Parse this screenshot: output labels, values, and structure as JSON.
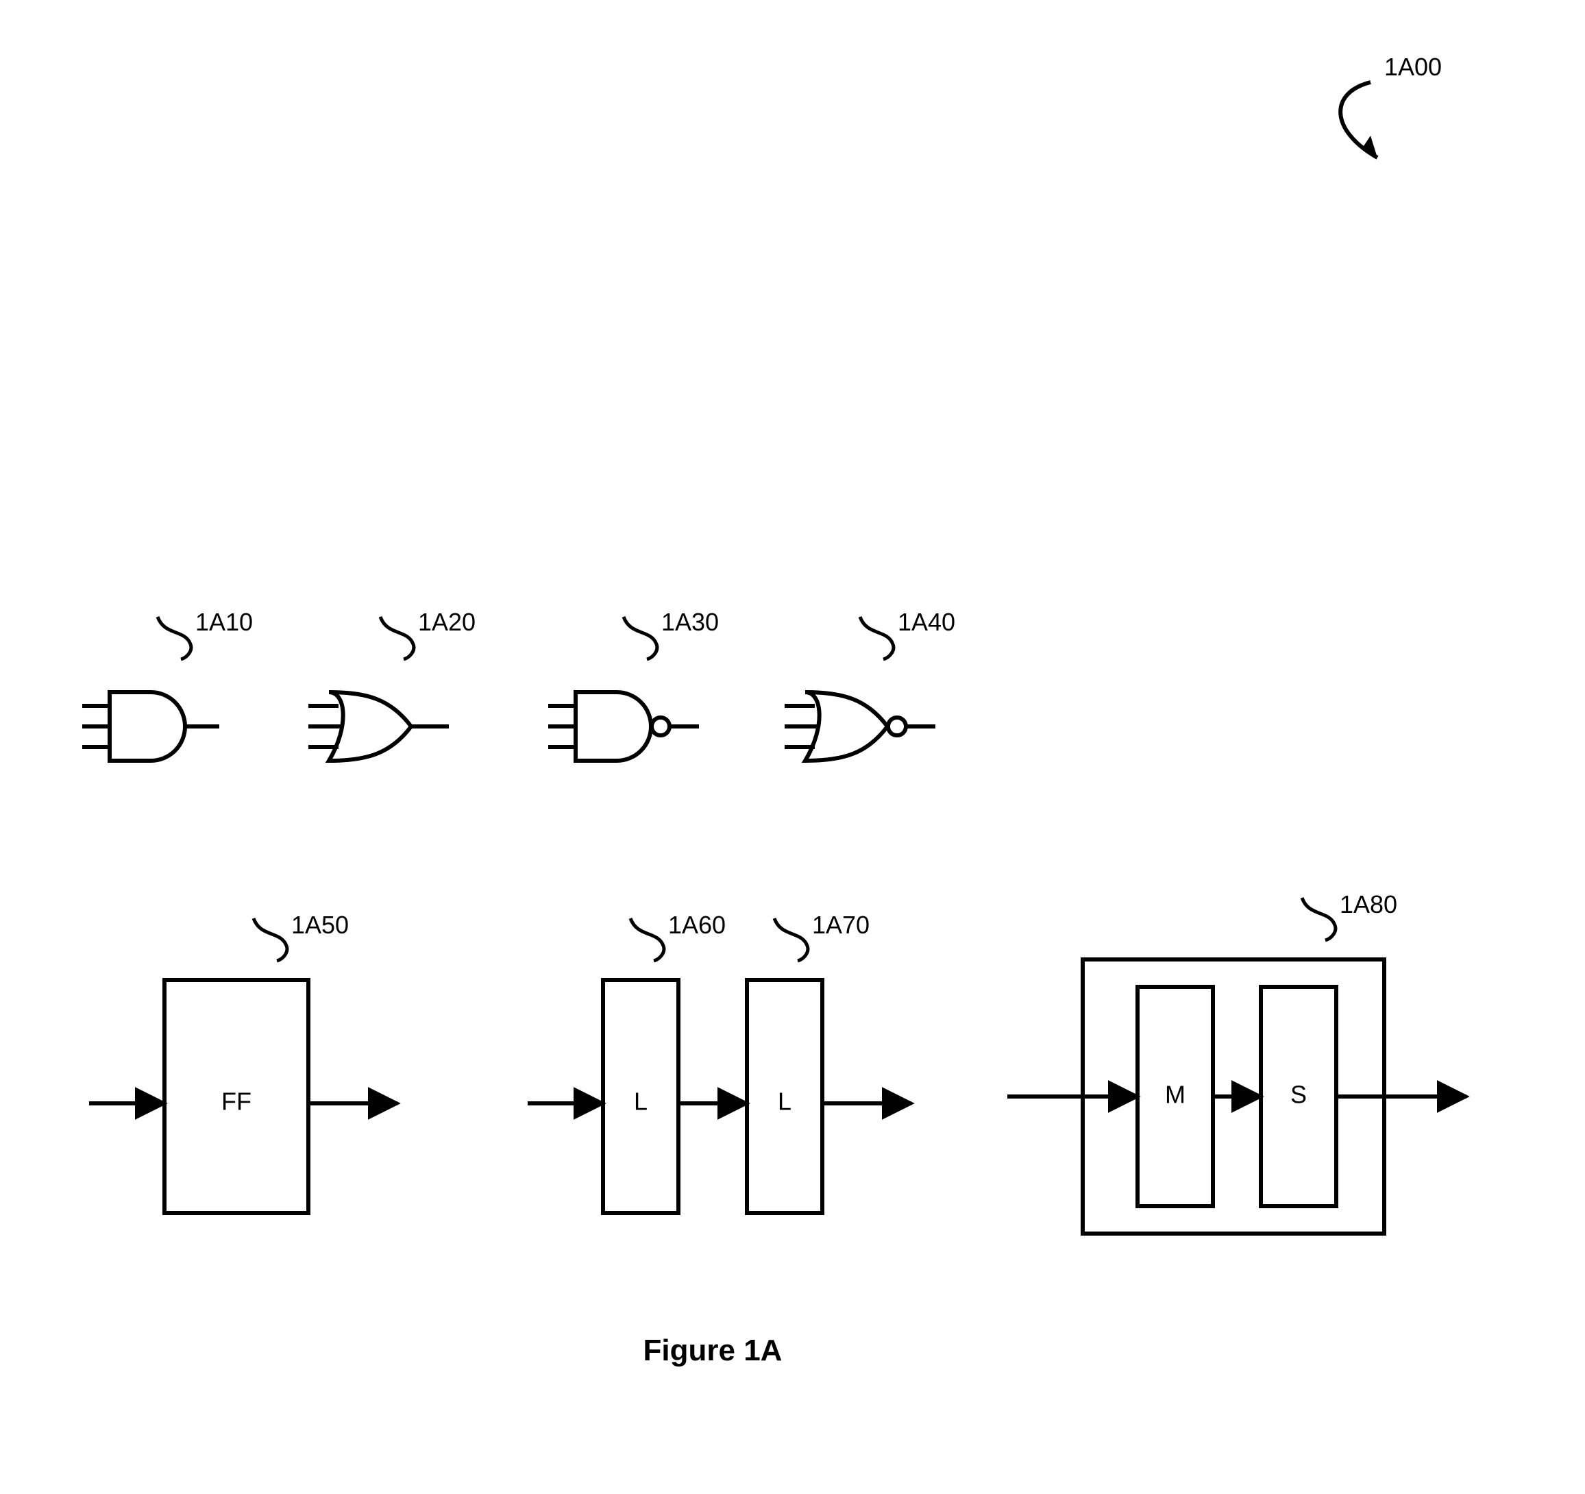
{
  "figure": {
    "caption": "Figure 1A",
    "overall_ref": "1A00",
    "gates": {
      "and": {
        "ref": "1A10"
      },
      "or": {
        "ref": "1A20"
      },
      "nand": {
        "ref": "1A30"
      },
      "nor": {
        "ref": "1A40"
      }
    },
    "blocks": {
      "ff": {
        "ref": "1A50",
        "label": "FF"
      },
      "latch1": {
        "ref": "1A60",
        "label": "L"
      },
      "latch2": {
        "ref": "1A70",
        "label": "L"
      },
      "ms": {
        "ref": "1A80",
        "master_label": "M",
        "slave_label": "S"
      }
    }
  },
  "chart_data": {
    "type": "diagram",
    "title": "Figure 1A",
    "elements": [
      {
        "id": "1A00",
        "name": "figure-reference",
        "description": "Overall figure reference arrow (top-right)"
      },
      {
        "id": "1A10",
        "name": "AND gate",
        "inputs": 3,
        "outputs": 1
      },
      {
        "id": "1A20",
        "name": "OR gate",
        "inputs": 3,
        "outputs": 1
      },
      {
        "id": "1A30",
        "name": "NAND gate",
        "inputs": 3,
        "outputs": 1
      },
      {
        "id": "1A40",
        "name": "NOR gate",
        "inputs": 3,
        "outputs": 1
      },
      {
        "id": "1A50",
        "name": "Flip-Flop block",
        "label": "FF",
        "inputs": 1,
        "outputs": 1
      },
      {
        "id": "1A60",
        "name": "Latch block 1",
        "label": "L",
        "inputs": 1,
        "outputs": 1,
        "cascades_into": "1A70"
      },
      {
        "id": "1A70",
        "name": "Latch block 2",
        "label": "L",
        "inputs": 1,
        "outputs": 1
      },
      {
        "id": "1A80",
        "name": "Master-Slave container",
        "contains": [
          "M",
          "S"
        ],
        "inputs": 1,
        "outputs": 1,
        "internal_flow": "input → M → S → output"
      }
    ]
  }
}
